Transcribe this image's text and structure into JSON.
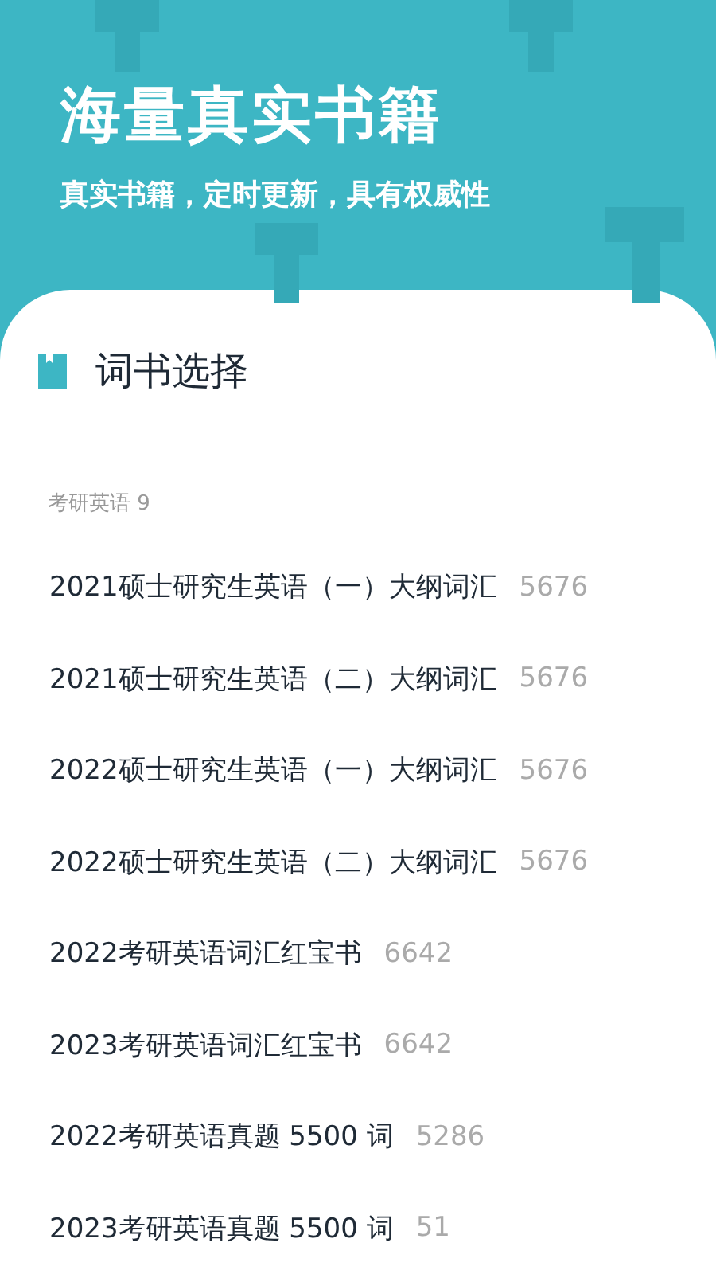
{
  "header": {
    "title": "海量真实书籍",
    "subtitle": "真实书籍，定时更新，具有权威性"
  },
  "section": {
    "title": "词书选择"
  },
  "group": {
    "label": "考研英语 9"
  },
  "books": [
    {
      "name": "2021硕士研究生英语（一）大纲词汇",
      "count": "5676"
    },
    {
      "name": "2021硕士研究生英语（二）大纲词汇",
      "count": "5676"
    },
    {
      "name": "2022硕士研究生英语（一）大纲词汇",
      "count": "5676"
    },
    {
      "name": "2022硕士研究生英语（二）大纲词汇",
      "count": "5676"
    },
    {
      "name": "2022考研英语词汇红宝书",
      "count": "6642"
    },
    {
      "name": "2023考研英语词汇红宝书",
      "count": "6642"
    },
    {
      "name": "2022考研英语真题 5500 词",
      "count": "5286"
    },
    {
      "name": "2023考研英语真题 5500 词",
      "count": "51"
    }
  ]
}
